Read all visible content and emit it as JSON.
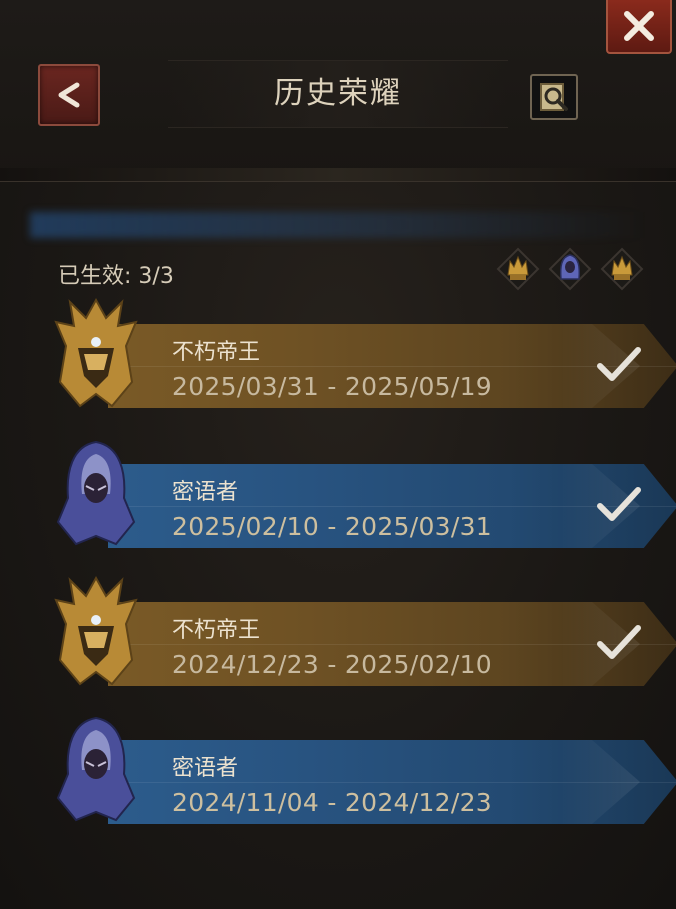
{
  "header": {
    "title": "历史荣耀"
  },
  "status": {
    "text": "已生效: 3/3"
  },
  "badges": [
    "gold-crown-icon",
    "hooded-figure-icon",
    "gold-crown-icon"
  ],
  "records": [
    {
      "name": "不朽帝王",
      "date": "2025/03/31 - 2025/05/19",
      "style": "gold",
      "checked": true
    },
    {
      "name": "密语者",
      "date": "2025/02/10 - 2025/03/31",
      "style": "blue",
      "checked": true
    },
    {
      "name": "不朽帝王",
      "date": "2024/12/23 - 2025/02/10",
      "style": "gold",
      "checked": true
    },
    {
      "name": "密语者",
      "date": "2024/11/04 - 2024/12/23",
      "style": "blue",
      "checked": false
    }
  ],
  "colors": {
    "gold_ribbon": "#7a5a26",
    "blue_ribbon": "#2c5c8c",
    "close_button": "#8a2a1c",
    "background": "#1a1714"
  }
}
